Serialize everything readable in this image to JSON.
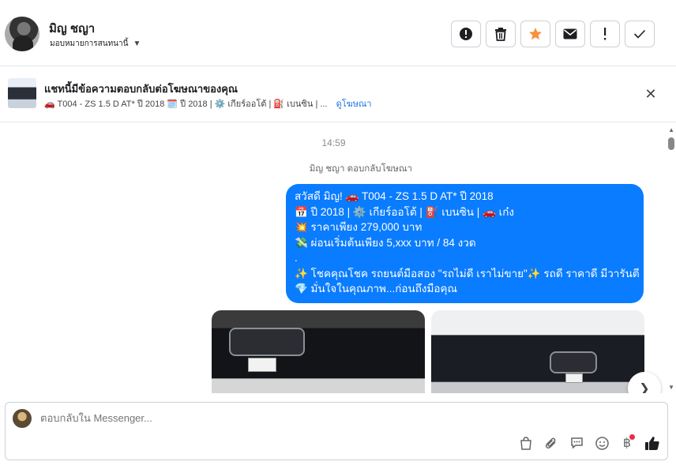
{
  "header": {
    "contact_name": "มิญ ชญา",
    "assign_label": "มอบหมายการสนทนานี้",
    "actions": [
      {
        "name": "report-button",
        "icon": "alert-circle-icon"
      },
      {
        "name": "delete-button",
        "icon": "trash-icon"
      },
      {
        "name": "star-button",
        "icon": "star-icon"
      },
      {
        "name": "mark-unread-button",
        "icon": "envelope-icon"
      },
      {
        "name": "spam-button",
        "icon": "exclamation-icon"
      },
      {
        "name": "mark-done-button",
        "icon": "check-icon"
      }
    ]
  },
  "banner": {
    "title": "แชทนี้มีข้อความตอบกลับต่อโฆษณาของคุณ",
    "subtitle": "🚗 T004 - ZS 1.5 D AT* ปี 2018 🗓️ ปี 2018 | ⚙️ เกียร์ออโต้ | ⛽ เบนซิน | ...",
    "link": "ดูโฆษณา"
  },
  "chat": {
    "time": "14:59",
    "replied_label": "มิญ ชญา ตอบกลับโฆษณา",
    "message_lines": [
      "สวัสดี มิญ! 🚗 T004 - ZS 1.5 D AT* ปี 2018",
      "📅 ปี 2018 | ⚙️ เกียร์ออโต้ | ⛽ เบนซิน | 🚗 เก๋ง",
      "💥 ราคาเพียง 279,000 บาท",
      "💸 ผ่อนเริ่มต้นเพียง 5,xxx บาท / 84 งวด",
      ".",
      "✨ โชคคุณโชค รถยนต์มือสอง \"รถไม่ดี เราไม่ขาย\"✨ รถดี ราคาดี มีวารันตี",
      "💎 มั่นใจในคุณภาพ...ก่อนถึงมือคุณ"
    ]
  },
  "composer": {
    "placeholder": "ตอบกลับใน Messenger...",
    "tools": [
      "shopping-bag-icon",
      "paperclip-icon",
      "saved-reply-icon",
      "emoji-icon",
      "baht-payment-icon",
      "thumbs-up-icon"
    ]
  },
  "colors": {
    "accent": "#0a7cff",
    "star": "#f7923b",
    "link": "#1b74e4",
    "badge": "#f02849"
  }
}
